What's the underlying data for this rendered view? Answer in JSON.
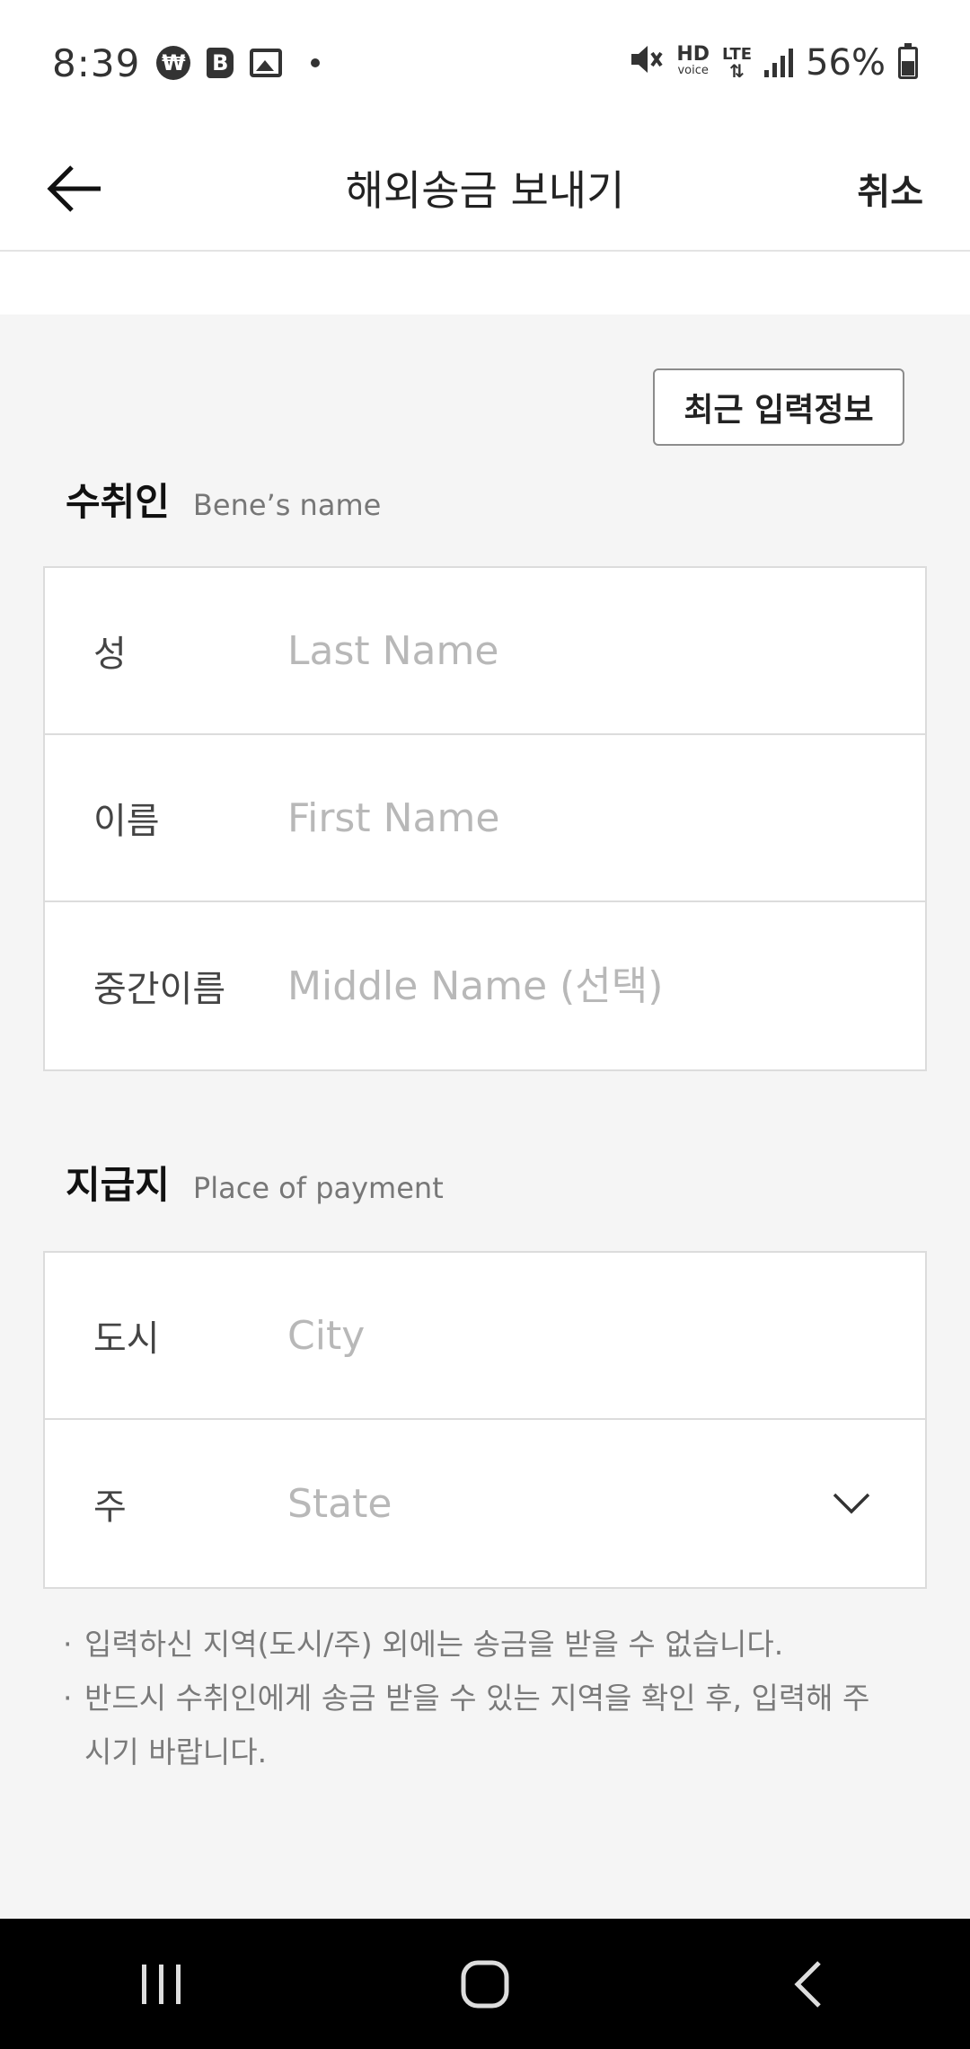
{
  "status_bar": {
    "time": "8:39",
    "won_glyph": "₩",
    "b_glyph": "B",
    "hd_label": "HD",
    "voice_label": "voice",
    "lte_label": "LTE",
    "battery": "56%"
  },
  "header": {
    "title": "해외송금 보내기",
    "cancel_label": "취소"
  },
  "recent_button_label": "최근 입력정보",
  "beneficiary": {
    "title": "수취인",
    "subtitle": "Bene’s name",
    "fields": [
      {
        "label": "성",
        "placeholder": "Last Name"
      },
      {
        "label": "이름",
        "placeholder": "First Name"
      },
      {
        "label": "중간이름",
        "placeholder": "Middle Name (선택)"
      }
    ]
  },
  "payment_place": {
    "title": "지급지",
    "subtitle": "Place of payment",
    "fields": [
      {
        "label": "도시",
        "placeholder": "City"
      },
      {
        "label": "주",
        "placeholder": "State"
      }
    ]
  },
  "notes": [
    "입력하신 지역(도시/주) 외에는 송금을 받을 수 없습니다.",
    "반드시 수취인에게 송금 받을 수 있는 지역을 확인 후, 입력해 주시기 바랍니다."
  ],
  "note_bullet": "·",
  "icons": {
    "back": "arrow-left-icon",
    "dropdown": "chevron-down-icon",
    "nav_recents": "recents-icon",
    "nav_home": "home-icon",
    "nav_back": "nav-back-icon"
  }
}
